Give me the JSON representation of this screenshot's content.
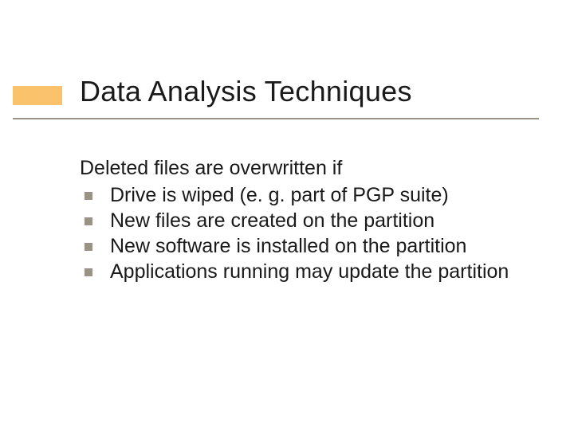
{
  "title": "Data Analysis Techniques",
  "intro": "Deleted files are overwritten if",
  "bullets": [
    "Drive is wiped (e. g. part of PGP suite)",
    "New files are created on the partition",
    "New software is installed on the partition",
    "Applications running may update the partition"
  ]
}
